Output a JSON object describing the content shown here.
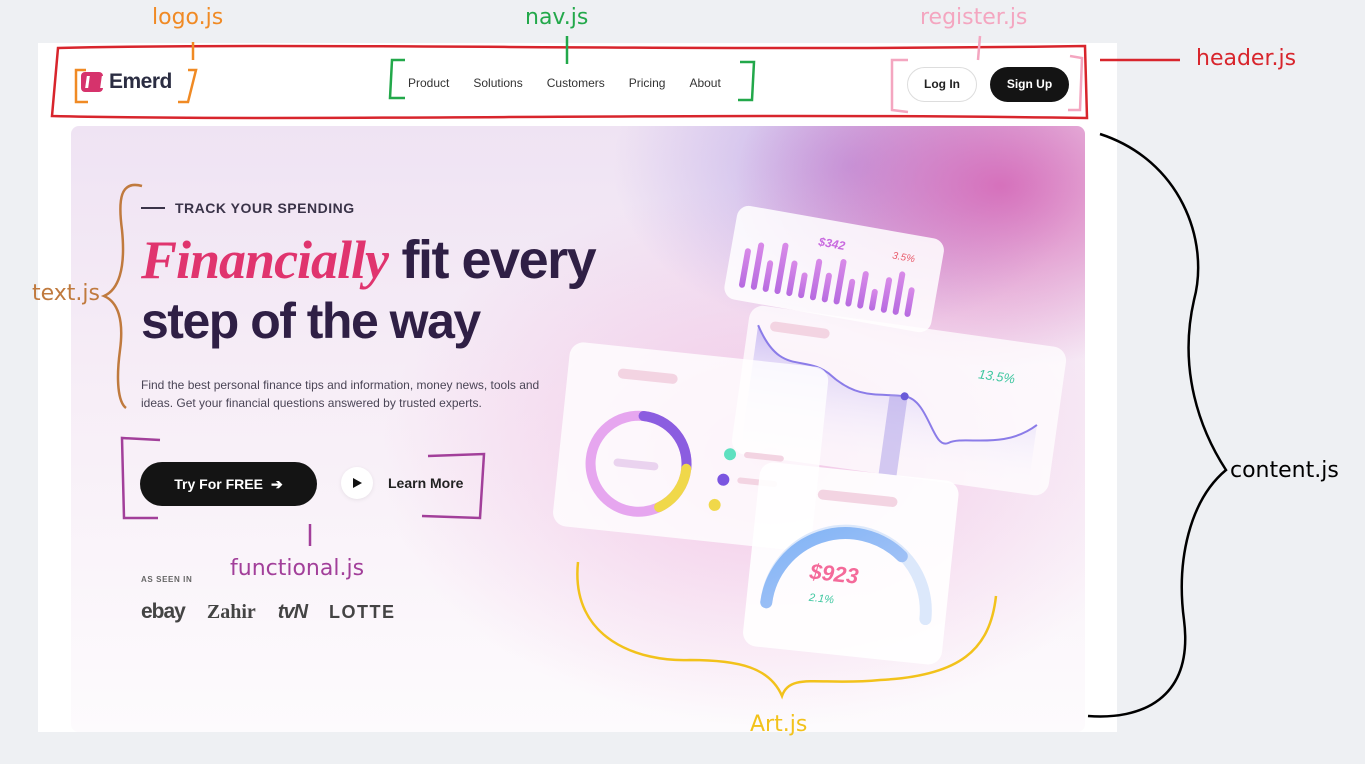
{
  "header": {
    "logo_text": "Emerd",
    "nav": [
      "Product",
      "Solutions",
      "Customers",
      "Pricing",
      "About"
    ],
    "login_label": "Log In",
    "signup_label": "Sign Up"
  },
  "hero": {
    "eyebrow": "TRACK YOUR SPENDING",
    "headline_italic": "Financially",
    "headline_rest": " fit every",
    "headline_line2": "step of the way",
    "description": "Find the best personal finance tips and information, money news, tools and ideas. Get your financial questions answered by trusted experts.",
    "cta_primary": "Try For FREE",
    "cta_secondary": "Learn More",
    "as_seen_in": "AS SEEN IN",
    "brands": [
      "ebay",
      "Zahir",
      "tvN",
      "LOTTE"
    ]
  },
  "art": {
    "card1_value": "$342",
    "card1_change": "3.5%",
    "card2_change": "13.5%",
    "card4_value": "$923",
    "card4_change": "2.1%"
  },
  "annotations": {
    "logo": "logo.js",
    "nav": "nav.js",
    "register": "register.js",
    "header": "header.js",
    "text": "text.js",
    "functional": "functional.js",
    "content": "content.js",
    "art": "Art.js"
  },
  "colors": {
    "accent": "#e0346e",
    "heading": "#2f1f45",
    "button_dark": "#141414",
    "ann_logo": "#f08a24",
    "ann_nav": "#22a84a",
    "ann_register": "#f4a6c0",
    "ann_header": "#d8252c",
    "ann_text": "#c07a3e",
    "ann_functional": "#a23f9a",
    "ann_content": "#000000",
    "ann_art": "#f2c21b"
  }
}
